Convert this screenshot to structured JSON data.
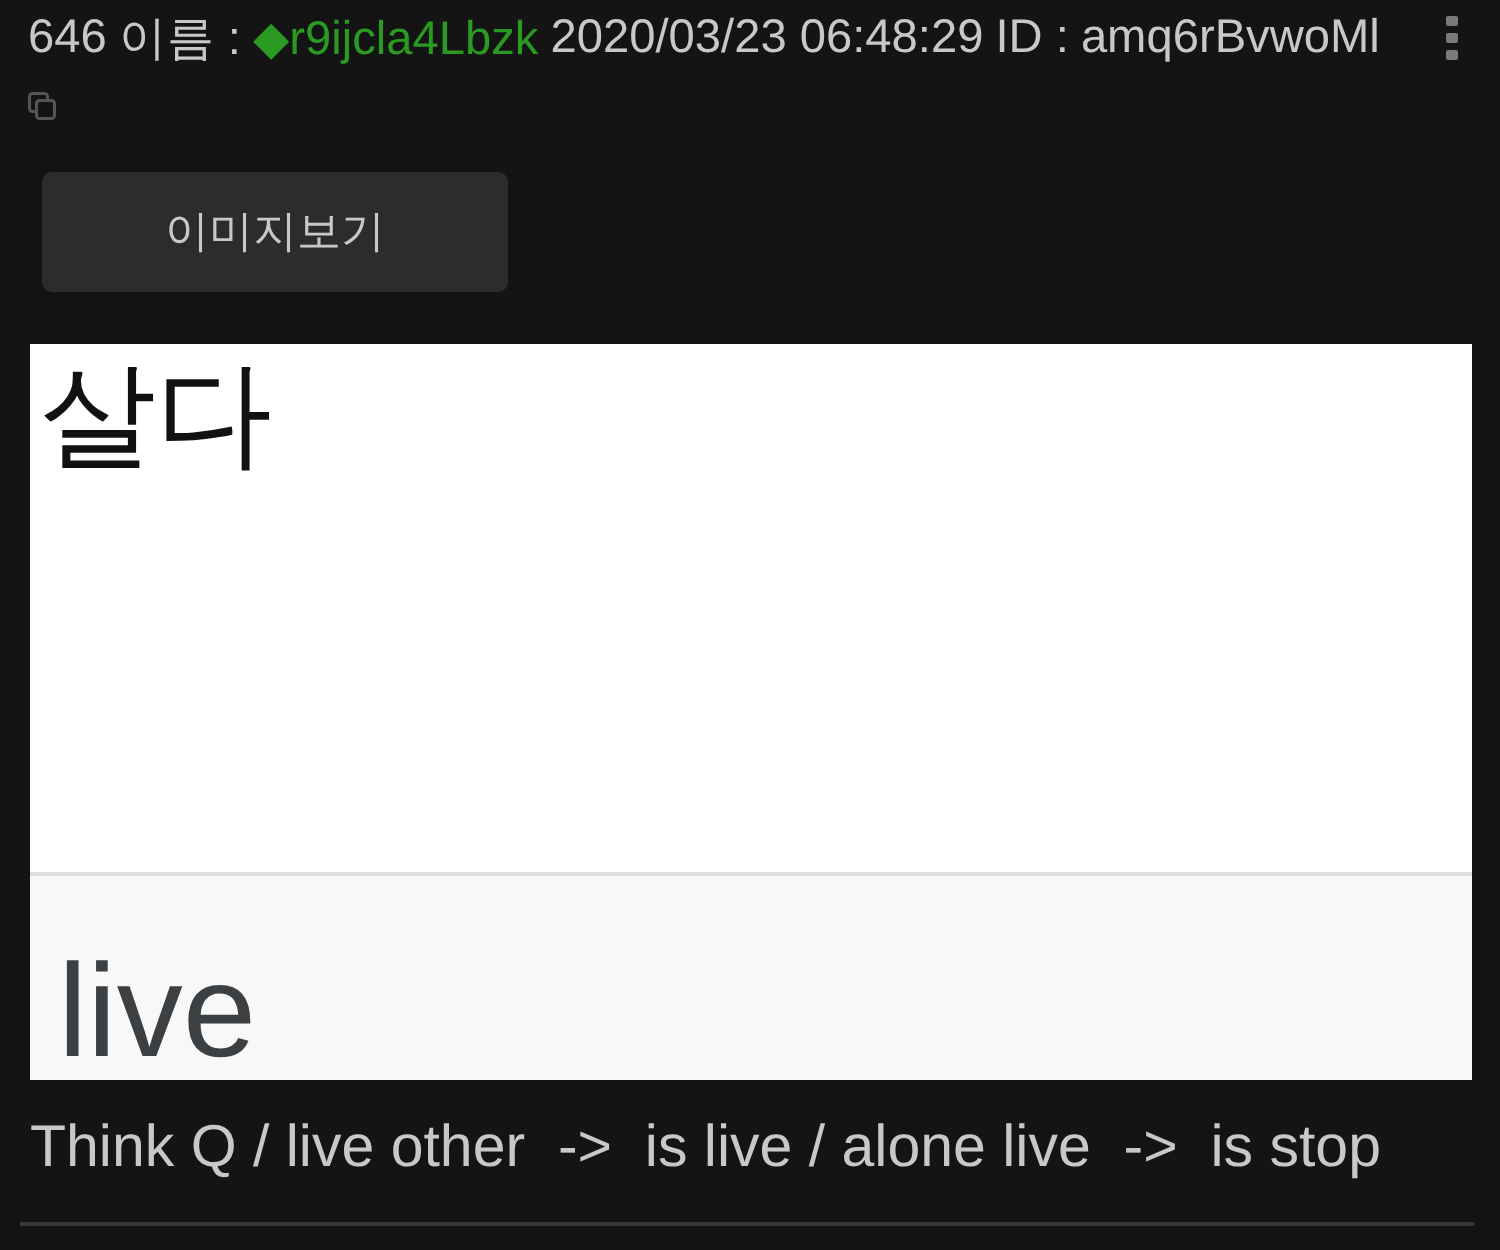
{
  "post": {
    "number": "646",
    "name_label": "이름 :",
    "trip": "◆r9ijcla4Lbzk",
    "timestamp": "2020/03/23 06:48:29",
    "id_label": "ID :",
    "id": "amq6rBvwoMl"
  },
  "image_button": {
    "label": "이미지보기"
  },
  "attached_image": {
    "source_word": "살다",
    "translation": "live"
  },
  "message": "Think Q / live other  ->  is live / alone live  ->  is stop"
}
